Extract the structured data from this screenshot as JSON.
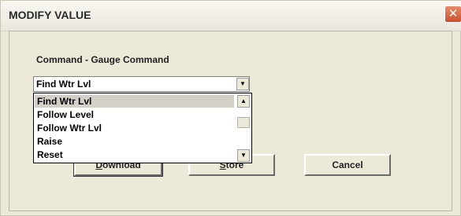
{
  "window": {
    "title": "MODIFY VALUE",
    "close_glyph": "✕"
  },
  "form": {
    "command_label": "Command - Gauge Command",
    "combo_value": "Find Wtr Lvl",
    "combo_arrow": "▼"
  },
  "dropdown": {
    "items": [
      "Find Wtr Lvl",
      "Follow Level",
      "Follow Wtr Lvl",
      "Raise",
      "Reset"
    ],
    "selected_index": 0,
    "scroll_up": "▲",
    "scroll_down": "▼"
  },
  "buttons": {
    "download_label_hotkey": "D",
    "download_label_rest": "ownload",
    "store_label_hotkey": "S",
    "store_label_rest": "tore",
    "cancel_label": "Cancel"
  },
  "icons": {
    "close": "close-icon",
    "combo_arrow": "chevron-down-icon",
    "scroll_up": "chevron-up-icon",
    "scroll_down": "chevron-down-icon"
  }
}
